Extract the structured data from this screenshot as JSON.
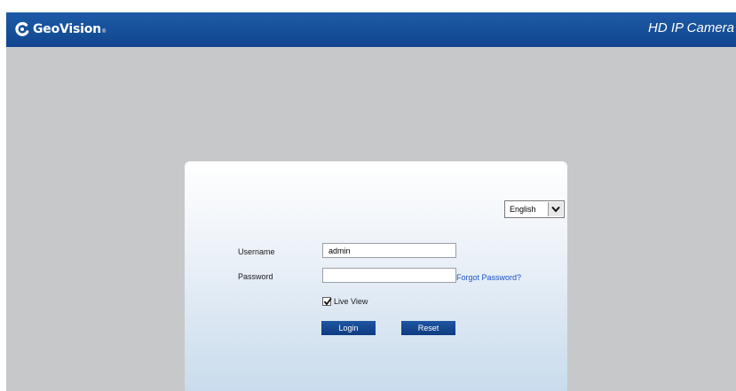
{
  "header": {
    "logo_text": "GeoVision",
    "logo_tm": "®",
    "product_title": "HD IP Camera"
  },
  "login": {
    "language": {
      "selected": "English"
    },
    "username": {
      "label": "Username",
      "value": "admin"
    },
    "password": {
      "label": "Password",
      "value": ""
    },
    "forgot_password": "Forgot Password?",
    "live_view": {
      "label": "Live View",
      "checked": true
    },
    "login_button": "Login",
    "reset_button": "Reset"
  },
  "colors": {
    "header_blue": "#1a56a0",
    "background_gray": "#c7c8ca",
    "button_blue": "#144a94",
    "link_blue": "#1b52c4"
  },
  "icons": {
    "logo": "geovision-logo-icon",
    "dropdown": "chevron-down-icon",
    "checkbox": "checkmark-icon"
  }
}
